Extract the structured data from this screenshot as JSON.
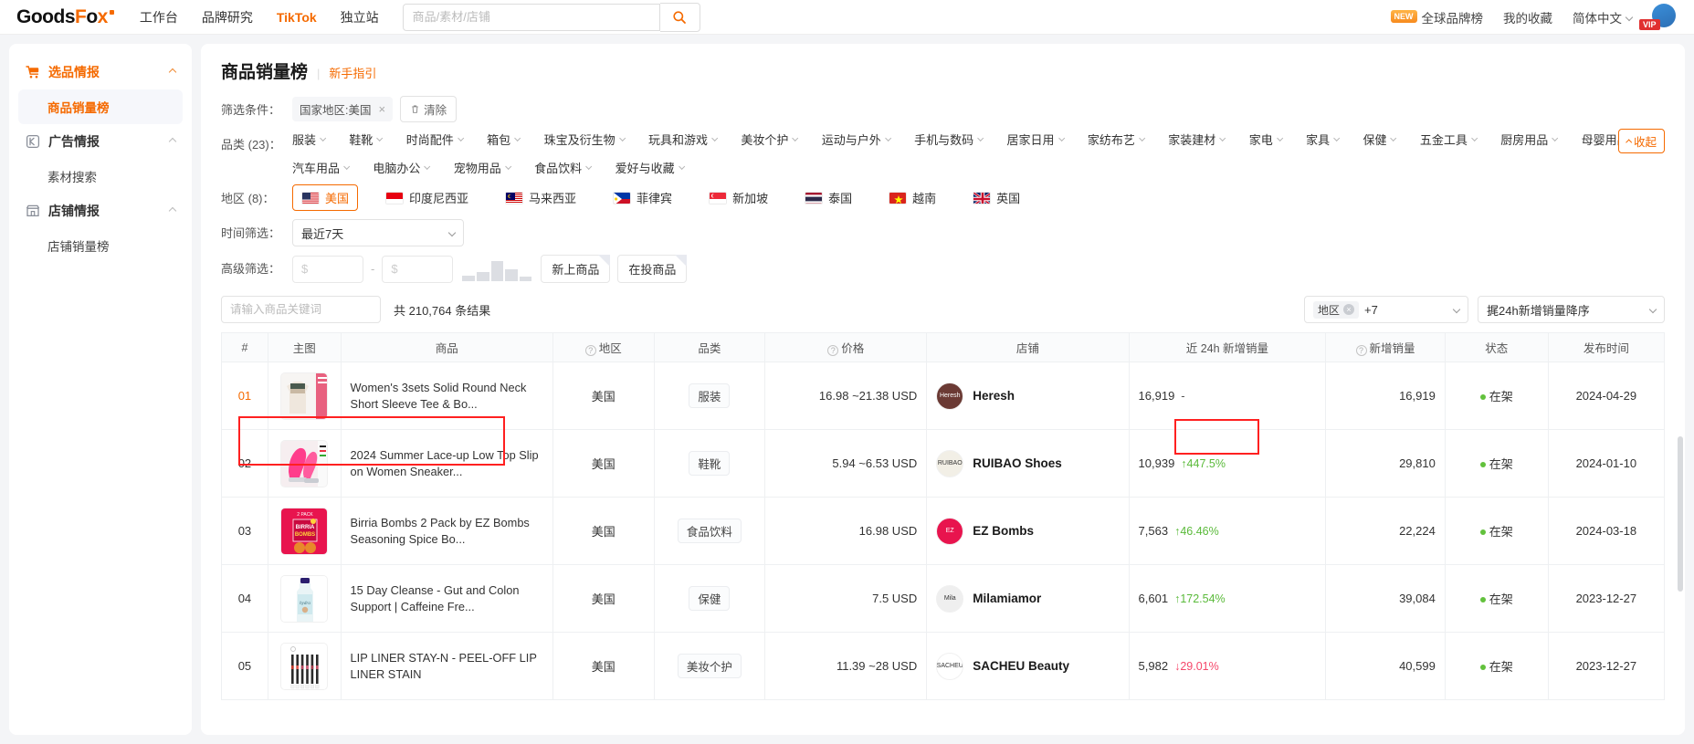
{
  "topnav": {
    "logo": "GoodsFox",
    "links": [
      {
        "label": "工作台",
        "active": false
      },
      {
        "label": "品牌研究",
        "active": false
      },
      {
        "label": "TikTok",
        "active": true
      },
      {
        "label": "独立站",
        "active": false
      }
    ],
    "search_placeholder": "商品/素材/店铺",
    "search_value": "",
    "new_badge": "NEW",
    "global_brand": "全球品牌榜",
    "favorites": "我的收藏",
    "language": "简体中文",
    "vip": "VIP"
  },
  "sidebar": {
    "groups": [
      {
        "label": "选品情报",
        "icon": "cart-icon",
        "active": true,
        "items": [
          {
            "label": "商品销量榜",
            "selected": true
          }
        ]
      },
      {
        "label": "广告情报",
        "icon": "ad-icon",
        "active": false,
        "items": [
          {
            "label": "素材搜索",
            "selected": false
          }
        ]
      },
      {
        "label": "店铺情报",
        "icon": "shop-icon",
        "active": false,
        "items": [
          {
            "label": "店铺销量榜",
            "selected": false
          }
        ]
      }
    ]
  },
  "page": {
    "title": "商品销量榜",
    "guide_link": "新手指引"
  },
  "filters": {
    "condition_label": "筛选条件：",
    "condition_chip": "国家地区:美国",
    "clear_label": "清除",
    "category_label": "品类 (23)：",
    "categories": [
      "服装",
      "鞋靴",
      "时尚配件",
      "箱包",
      "珠宝及衍生物",
      "玩具和游戏",
      "美妆个护",
      "运动与户外",
      "手机与数码",
      "居家日用",
      "家纺布艺",
      "家装建材",
      "家电",
      "家具",
      "保健",
      "五金工具",
      "厨房用品",
      "母婴用品",
      "汽车用品",
      "电脑办公",
      "宠物用品",
      "食品饮料",
      "爱好与收藏"
    ],
    "collapse_label": "收起",
    "region_label": "地区 (8)：",
    "regions": [
      {
        "name": "美国",
        "flag": "us",
        "selected": true
      },
      {
        "name": "印度尼西亚",
        "flag": "id",
        "selected": false
      },
      {
        "name": "马来西亚",
        "flag": "my",
        "selected": false
      },
      {
        "name": "菲律宾",
        "flag": "ph",
        "selected": false
      },
      {
        "name": "新加坡",
        "flag": "sg",
        "selected": false
      },
      {
        "name": "泰国",
        "flag": "th",
        "selected": false
      },
      {
        "name": "越南",
        "flag": "vn",
        "selected": false
      },
      {
        "name": "英国",
        "flag": "gb",
        "selected": false
      }
    ],
    "time_label": "时间筛选：",
    "time_value": "最近7天",
    "advanced_label": "高级筛选：",
    "price_min_placeholder": "$",
    "price_max_placeholder": "$",
    "price_min_value": "",
    "price_max_value": "",
    "new_product_btn": "新上商品",
    "advertising_btn": "在投商品"
  },
  "toolbar": {
    "keyword_placeholder": "请输入商品关键词",
    "keyword_value": "",
    "result_count": "共 210,764 条结果",
    "region_select_chip": "地区",
    "region_select_extra": "+7",
    "sort_value": "捤24h新增销量降序"
  },
  "table": {
    "headers": [
      {
        "label": "#",
        "help": false
      },
      {
        "label": "主图",
        "help": false
      },
      {
        "label": "商品",
        "help": false
      },
      {
        "label": "地区",
        "help": true
      },
      {
        "label": "品类",
        "help": false
      },
      {
        "label": "价格",
        "help": true
      },
      {
        "label": "店铺",
        "help": false
      },
      {
        "label": "近 24h 新增销量",
        "help": false
      },
      {
        "label": "新增销量",
        "help": true
      },
      {
        "label": "状态",
        "help": false
      },
      {
        "label": "发布时间",
        "help": false
      }
    ],
    "rows": [
      {
        "rank": "01",
        "product": "Women's 3sets Solid Round Neck Short Sleeve Tee & Bo...",
        "region": "美国",
        "category": "服装",
        "price": "16.98 ~21.38 USD",
        "shop": "Heresh",
        "shop_logo_text": "Heresh",
        "shop_color": "#6b3a34",
        "sales_24h": "16,919",
        "delta": "-",
        "delta_dir": "none",
        "new_sales": "16,919",
        "status": "在架",
        "date": "2024-04-29",
        "highlighted": true,
        "thumb": "apparel"
      },
      {
        "rank": "02",
        "product": "2024 Summer Lace-up Low Top Slip on Women Sneaker...",
        "region": "美国",
        "category": "鞋靴",
        "price": "5.94 ~6.53 USD",
        "shop": "RUIBAO Shoes",
        "shop_logo_text": "RUIBAO",
        "shop_color": "#f2efe6",
        "sales_24h": "10,939",
        "delta": "447.5%",
        "delta_dir": "up",
        "new_sales": "29,810",
        "status": "在架",
        "date": "2024-01-10",
        "highlighted": false,
        "thumb": "shoes"
      },
      {
        "rank": "03",
        "product": "Birria Bombs 2 Pack by EZ Bombs Seasoning Spice Bo...",
        "region": "美国",
        "category": "食品饮料",
        "price": "16.98 USD",
        "shop": "EZ Bombs",
        "shop_logo_text": "EZ",
        "shop_color": "#e8144e",
        "sales_24h": "7,563",
        "delta": "46.46%",
        "delta_dir": "up",
        "new_sales": "22,224",
        "status": "在架",
        "date": "2024-03-18",
        "highlighted": false,
        "thumb": "bombs"
      },
      {
        "rank": "04",
        "product": "15 Day Cleanse - Gut and Colon Support | Caffeine Fre...",
        "region": "美国",
        "category": "保健",
        "price": "7.5 USD",
        "shop": "Milamiamor",
        "shop_logo_text": "Mila",
        "shop_color": "#efefef",
        "sales_24h": "6,601",
        "delta": "172.54%",
        "delta_dir": "up",
        "new_sales": "39,084",
        "status": "在架",
        "date": "2023-12-27",
        "highlighted": false,
        "thumb": "bottle"
      },
      {
        "rank": "05",
        "product": "LIP LINER STAY-N - PEEL-OFF LIP LINER STAIN",
        "region": "美国",
        "category": "美妆个护",
        "price": "11.39 ~28 USD",
        "shop": "SACHEU Beauty",
        "shop_logo_text": "SACHEU",
        "shop_color": "#ffffff",
        "sales_24h": "5,982",
        "delta": "29.01%",
        "delta_dir": "down",
        "new_sales": "40,599",
        "status": "在架",
        "date": "2023-12-27",
        "highlighted": false,
        "thumb": "lipliner"
      }
    ]
  },
  "colors": {
    "brand": "#f56a00",
    "up": "#5aba3a",
    "down": "#f5476a",
    "status": "#62c13c",
    "highlight": "#ff2020"
  }
}
